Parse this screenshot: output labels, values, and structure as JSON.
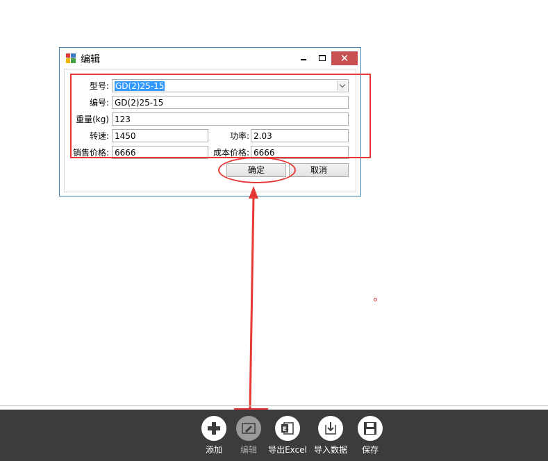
{
  "dialog": {
    "title": "编辑",
    "icon": "app-form-icon",
    "close_glyph": "✕",
    "fields": {
      "model": {
        "label": "型号:",
        "value": "GD(2)25-15"
      },
      "code": {
        "label": "编号:",
        "value": "GD(2)25-15"
      },
      "weight": {
        "label": "重量(kg)",
        "value": "123"
      },
      "speed": {
        "label": "转速:",
        "value": "1450"
      },
      "power": {
        "label": "功率:",
        "value": "2.03"
      },
      "sale_price": {
        "label": "销售价格:",
        "value": "6666"
      },
      "cost_price": {
        "label": "成本价格:",
        "value": "6666"
      }
    },
    "ok_label": "确定",
    "cancel_label": "取消"
  },
  "toolbar": {
    "items": [
      {
        "label": "添加",
        "icon": "plus-icon"
      },
      {
        "label": "编辑",
        "icon": "edit-icon",
        "state": "disabled"
      },
      {
        "label": "导出Excel",
        "icon": "excel-icon"
      },
      {
        "label": "导入数据",
        "icon": "import-icon"
      },
      {
        "label": "保存",
        "icon": "save-icon"
      }
    ]
  },
  "annotations": {
    "color": "#e53935"
  }
}
